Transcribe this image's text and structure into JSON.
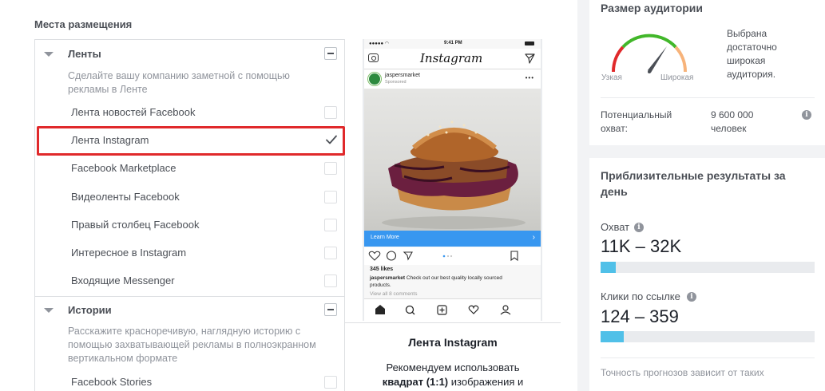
{
  "placements": {
    "title": "Места размещения",
    "feeds": {
      "label": "Ленты",
      "description": "Сделайте вашу компанию заметной с помощью рекламы в Ленте",
      "items": [
        {
          "label": "Лента новостей Facebook",
          "checked": false
        },
        {
          "label": "Лента Instagram",
          "checked": true
        },
        {
          "label": "Facebook Marketplace",
          "checked": false
        },
        {
          "label": "Видеоленты Facebook",
          "checked": false
        },
        {
          "label": "Правый столбец Facebook",
          "checked": false
        },
        {
          "label": "Интересное в Instagram",
          "checked": false
        },
        {
          "label": "Входящие Messenger",
          "checked": false
        }
      ]
    },
    "stories": {
      "label": "Истории",
      "description": "Расскажите красноречивую, наглядную историю с помощью захватывающей рекламы в полноэкранном вертикальном формате",
      "items": [
        {
          "label": "Facebook Stories",
          "checked": false
        }
      ]
    }
  },
  "preview": {
    "status_time": "9:41 PM",
    "app_name": "Instagram",
    "username": "jaspersmarket",
    "sponsored": "Sponsored",
    "cta": "Learn More",
    "likes": "345 likes",
    "caption_user": "jaspersmarket",
    "caption_text": "Check out our best quality locally sourced products.",
    "comments": "View all 8 comments",
    "title": "Лента Instagram",
    "rec_line1": "Рекомендуем использовать",
    "rec_bold": "квадрат (1:1)",
    "rec_line2_rest": "изображения и"
  },
  "audience": {
    "title": "Размер аудитории",
    "gauge_low": "Узкая",
    "gauge_high": "Широкая",
    "status": "Выбрана достаточно широкая аудитория.",
    "status_lines": [
      "Выбрана",
      "достаточно",
      "широкая",
      "аудитория."
    ],
    "reach_label_lines": [
      "Потенциальный",
      "охват:"
    ],
    "reach_value_lines": [
      "9 600 000",
      "человек"
    ]
  },
  "results": {
    "title_lines": [
      "Приблизительные результаты за",
      "день"
    ],
    "reach_label": "Охват",
    "reach_value": "11K – 32K",
    "reach_fraction": 0.07,
    "clicks_label": "Клики по ссылке",
    "clicks_value": "124 – 359",
    "clicks_fraction": 0.11,
    "footnote": "Точность прогнозов зависит от таких"
  },
  "colors": {
    "highlight": "#e0292b",
    "bar": "#50c0e8",
    "cta": "#3897f0"
  }
}
